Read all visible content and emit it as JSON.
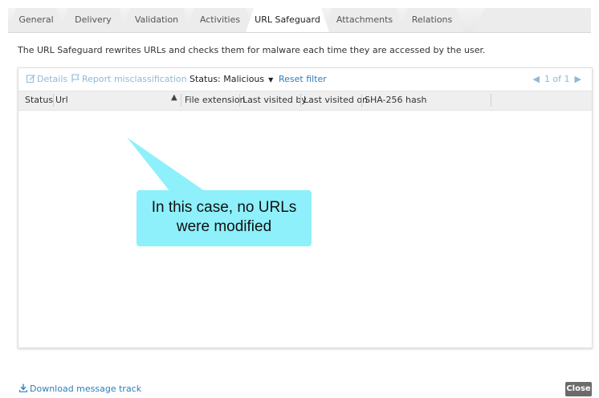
{
  "tabs": [
    {
      "label": "General"
    },
    {
      "label": "Delivery"
    },
    {
      "label": "Validation"
    },
    {
      "label": "Activities"
    },
    {
      "label": "URL Safeguard",
      "active": true
    },
    {
      "label": "Attachments"
    },
    {
      "label": "Relations"
    }
  ],
  "description": "The URL Safeguard rewrites URLs and checks them for malware each time they are accessed by the user.",
  "toolbar": {
    "details_label": "Details",
    "report_label": "Report misclassification",
    "status_filter": "Status: Malicious",
    "reset_filter_label": "Reset filter",
    "pager": "1 of 1"
  },
  "columns": [
    "Status",
    "Url",
    "File extension",
    "Last visited by",
    "Last visited on",
    "SHA-256 hash"
  ],
  "callout": {
    "text": "In this case, no URLs were modified",
    "color": "#8ef0fb"
  },
  "footer": {
    "download_label": "Download message track",
    "close_label": "Close"
  },
  "colors": {
    "link": "#2b7ec0",
    "disabled_link": "#8cbad8",
    "close_button": "#6b6b6b"
  }
}
